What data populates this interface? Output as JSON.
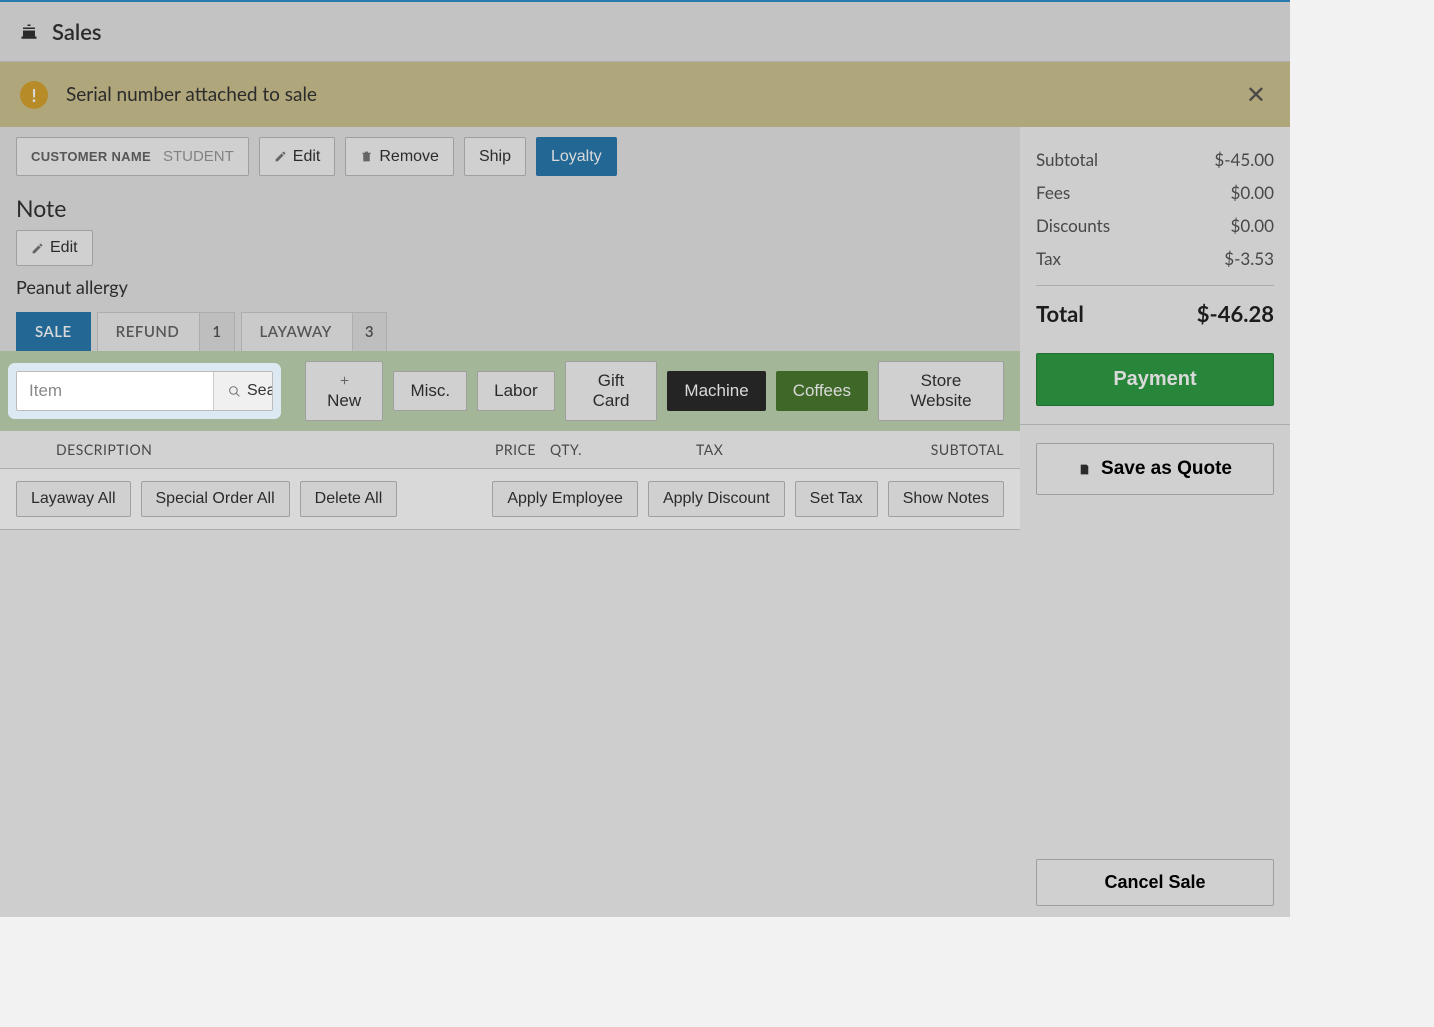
{
  "header": {
    "title": "Sales"
  },
  "alert": {
    "message": "Serial number attached to sale"
  },
  "customer": {
    "label": "CUSTOMER NAME",
    "name": "STUDENT",
    "edit": "Edit",
    "remove": "Remove",
    "ship": "Ship",
    "loyalty": "Loyalty"
  },
  "note": {
    "heading": "Note",
    "edit": "Edit",
    "text": "Peanut allergy"
  },
  "tabs": {
    "sale": "SALE",
    "refund": "REFUND",
    "refund_count": "1",
    "layaway": "LAYAWAY",
    "layaway_count": "3"
  },
  "search": {
    "placeholder": "Item",
    "button": "Search"
  },
  "quickbtns": {
    "new": "New",
    "misc": "Misc.",
    "labor": "Labor",
    "giftcard": "Gift Card",
    "machine": "Machine",
    "coffees": "Coffees",
    "website": "Store Website"
  },
  "columns": {
    "description": "DESCRIPTION",
    "price": "PRICE",
    "qty": "QTY.",
    "tax": "TAX",
    "subtotal": "SUBTOTAL"
  },
  "bulk": {
    "layaway_all": "Layaway All",
    "special_order_all": "Special Order All",
    "delete_all": "Delete All",
    "apply_employee": "Apply Employee",
    "apply_discount": "Apply Discount",
    "set_tax": "Set Tax",
    "show_notes": "Show Notes"
  },
  "totals": {
    "subtotal_label": "Subtotal",
    "subtotal": "$-45.00",
    "fees_label": "Fees",
    "fees": "$0.00",
    "discounts_label": "Discounts",
    "discounts": "$0.00",
    "tax_label": "Tax",
    "tax": "$-3.53",
    "total_label": "Total",
    "total": "$-46.28"
  },
  "actions": {
    "payment": "Payment",
    "save_quote": "Save as Quote",
    "cancel_sale": "Cancel Sale"
  }
}
